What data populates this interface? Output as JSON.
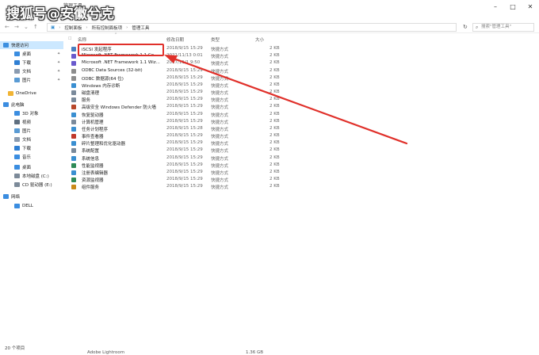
{
  "watermark": "搜狐号@安徽兮克",
  "window": {
    "title": "管理工具"
  },
  "address": {
    "crumbs": [
      "控制面板",
      "所有控制面板项",
      "管理工具"
    ],
    "search_placeholder": "搜索\"管理工具\""
  },
  "sidebar": {
    "items": [
      {
        "label": "快速访问",
        "icon": "star-icon",
        "color": "#3c8fe0",
        "pin": false
      },
      {
        "label": "桌面",
        "icon": "desktop-icon",
        "color": "#3b8de0",
        "pin": true
      },
      {
        "label": "下载",
        "icon": "download-icon",
        "color": "#2f7fd3",
        "pin": true
      },
      {
        "label": "文档",
        "icon": "document-icon",
        "color": "#8a9bb0",
        "pin": true
      },
      {
        "label": "图片",
        "icon": "picture-icon",
        "color": "#5a9bd4",
        "pin": true
      },
      {
        "label": "OneDrive",
        "icon": "cloud-icon",
        "color": "#f1b434",
        "pin": false
      },
      {
        "label": "此电脑",
        "icon": "computer-icon",
        "color": "#3b8de0",
        "pin": false
      },
      {
        "label": "3D 对象",
        "icon": "cube-icon",
        "color": "#3b8de0",
        "pin": false
      },
      {
        "label": "视频",
        "icon": "video-icon",
        "color": "#5f6f80",
        "pin": false
      },
      {
        "label": "图片",
        "icon": "picture-icon",
        "color": "#5a9bd4",
        "pin": false
      },
      {
        "label": "文档",
        "icon": "document-icon",
        "color": "#8a9bb0",
        "pin": false
      },
      {
        "label": "下载",
        "icon": "download-icon",
        "color": "#2f7fd3",
        "pin": false
      },
      {
        "label": "音乐",
        "icon": "music-icon",
        "color": "#3b8de0",
        "pin": false
      },
      {
        "label": "桌面",
        "icon": "desktop-icon",
        "color": "#3b8de0",
        "pin": false
      },
      {
        "label": "本地磁盘 (C:)",
        "icon": "disk-icon",
        "color": "#7c8a99",
        "pin": false
      },
      {
        "label": "CD 驱动器 (E:)",
        "icon": "cd-icon",
        "color": "#7c8a99",
        "pin": false
      },
      {
        "label": "网络",
        "icon": "network-icon",
        "color": "#3b8de0",
        "pin": false
      },
      {
        "label": "DELL",
        "icon": "monitor-icon",
        "color": "#3b8de0",
        "pin": false
      }
    ]
  },
  "columns": {
    "name": "名称",
    "date": "修改日期",
    "type": "类型",
    "size": "大小"
  },
  "files": [
    {
      "name": "iSCSI 发起程序",
      "date": "2018/9/15 15:29",
      "type": "快捷方式",
      "size": "2 KB",
      "color": "#4a7fc1"
    },
    {
      "name": "Microsoft .NET Framework 1.1 Co...",
      "date": "2021/11/13 0:01",
      "type": "快捷方式",
      "size": "2 KB",
      "color": "#6a5acd"
    },
    {
      "name": "Microsoft .NET Framework 1.1 Wiz...",
      "date": "2017/11/1 9:50",
      "type": "快捷方式",
      "size": "2 KB",
      "color": "#6a5acd"
    },
    {
      "name": "ODBC Data Sources (32-bit)",
      "date": "2018/9/15 15:29",
      "type": "快捷方式",
      "size": "2 KB",
      "color": "#8d8d8d"
    },
    {
      "name": "ODBC 数据源(64 位)",
      "date": "2018/9/15 15:29",
      "type": "快捷方式",
      "size": "2 KB",
      "color": "#8d8d8d"
    },
    {
      "name": "Windows 内存诊断",
      "date": "2018/9/15 15:29",
      "type": "快捷方式",
      "size": "2 KB",
      "color": "#3a8fd1"
    },
    {
      "name": "磁盘清理",
      "date": "2018/9/15 15:29",
      "type": "快捷方式",
      "size": "2 KB",
      "color": "#7a8a9b"
    },
    {
      "name": "服务",
      "date": "2018/9/15 15:29",
      "type": "快捷方式",
      "size": "2 KB",
      "color": "#7a8a9b"
    },
    {
      "name": "高级安全 Windows Defender 防火墙",
      "date": "2018/9/15 15:29",
      "type": "快捷方式",
      "size": "2 KB",
      "color": "#b7472a"
    },
    {
      "name": "恢复驱动器",
      "date": "2018/9/15 15:29",
      "type": "快捷方式",
      "size": "2 KB",
      "color": "#3a8fd1"
    },
    {
      "name": "计算机管理",
      "date": "2018/9/15 15:29",
      "type": "快捷方式",
      "size": "2 KB",
      "color": "#7a8a9b"
    },
    {
      "name": "任务计划程序",
      "date": "2018/9/15 15:28",
      "type": "快捷方式",
      "size": "2 KB",
      "color": "#3a8fd1"
    },
    {
      "name": "事件查看器",
      "date": "2018/9/15 15:29",
      "type": "快捷方式",
      "size": "2 KB",
      "color": "#c0392b"
    },
    {
      "name": "碎片整理和优化驱动器",
      "date": "2018/9/15 15:29",
      "type": "快捷方式",
      "size": "2 KB",
      "color": "#3a8fd1"
    },
    {
      "name": "系统配置",
      "date": "2018/9/15 15:29",
      "type": "快捷方式",
      "size": "2 KB",
      "color": "#7a8a9b"
    },
    {
      "name": "系统信息",
      "date": "2018/9/15 15:29",
      "type": "快捷方式",
      "size": "2 KB",
      "color": "#3a8fd1"
    },
    {
      "name": "性能监视器",
      "date": "2018/9/15 15:29",
      "type": "快捷方式",
      "size": "2 KB",
      "color": "#2e8b57"
    },
    {
      "name": "注册表编辑器",
      "date": "2018/9/15 15:29",
      "type": "快捷方式",
      "size": "2 KB",
      "color": "#3a8fd1"
    },
    {
      "name": "资源监视器",
      "date": "2018/9/15 15:29",
      "type": "快捷方式",
      "size": "2 KB",
      "color": "#2e8b57"
    },
    {
      "name": "组件服务",
      "date": "2018/9/15 15:29",
      "type": "快捷方式",
      "size": "2 KB",
      "color": "#c98a1a"
    }
  ],
  "status": {
    "count": "20 个项目"
  },
  "taskbar_peek": {
    "name": "Adobe Lightroom",
    "size": "1.36 GB"
  },
  "annotation_color": "#e0302a"
}
